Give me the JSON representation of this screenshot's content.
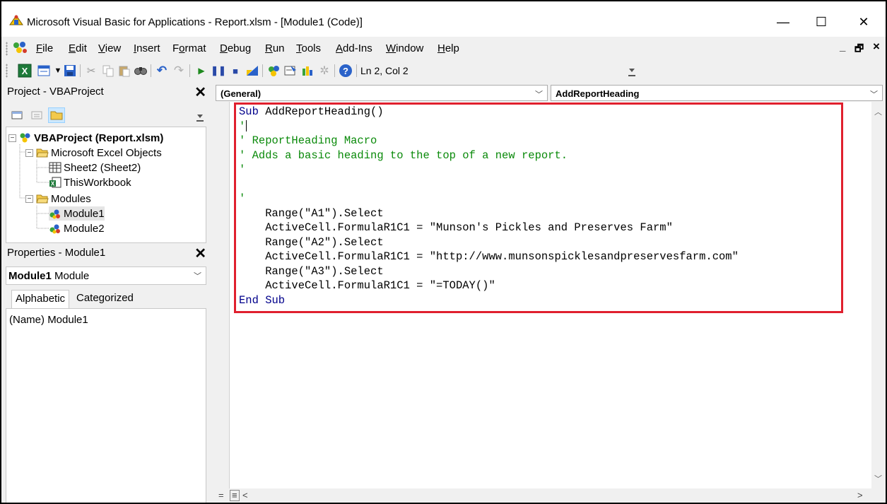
{
  "title": "Microsoft Visual Basic for Applications - Report.xlsm - [Module1 (Code)]",
  "window_controls": {
    "minimize": "—",
    "maximize": "☐",
    "close": "✕"
  },
  "menu": [
    {
      "label": "File",
      "underline": "F"
    },
    {
      "label": "Edit",
      "underline": "E"
    },
    {
      "label": "View",
      "underline": "V"
    },
    {
      "label": "Insert",
      "underline": "I"
    },
    {
      "label": "Format",
      "underline": "o"
    },
    {
      "label": "Debug",
      "underline": "D"
    },
    {
      "label": "Run",
      "underline": "R"
    },
    {
      "label": "Tools",
      "underline": "T"
    },
    {
      "label": "Add-Ins",
      "underline": "A"
    },
    {
      "label": "Window",
      "underline": "W"
    },
    {
      "label": "Help",
      "underline": "H"
    }
  ],
  "mdi_controls": {
    "minimize": "_",
    "restore": "🗗",
    "close": "×"
  },
  "toolbar": {
    "cursor_position": "Ln 2, Col 2",
    "buttons": [
      "view-excel-icon",
      "insert-module-icon",
      "save-icon",
      "cut-icon",
      "copy-icon",
      "paste-icon",
      "find-icon",
      "undo-icon",
      "redo-icon",
      "run-icon",
      "break-icon",
      "reset-icon",
      "design-mode-icon",
      "project-explorer-icon",
      "properties-icon",
      "object-browser-icon",
      "toolbox-icon",
      "help-icon"
    ]
  },
  "project": {
    "title": "Project - VBAProject",
    "close": "✕",
    "tree": {
      "root": "VBAProject (Report.xlsm)",
      "excel_objects_folder": "Microsoft Excel Objects",
      "excel_objects": [
        "Sheet2 (Sheet2)",
        "ThisWorkbook"
      ],
      "modules_folder": "Modules",
      "modules": [
        "Module1",
        "Module2"
      ]
    }
  },
  "properties": {
    "title": "Properties - Module1",
    "close": "✕",
    "object_name": "Module1",
    "object_type": "Module",
    "tabs": [
      "Alphabetic",
      "Categorized"
    ],
    "active_tab": "Alphabetic",
    "rows": [
      {
        "name": "(Name)",
        "value": "Module1"
      }
    ]
  },
  "code_window": {
    "object_combo": "(General)",
    "procedure_combo": "AddReportHeading",
    "lines": [
      {
        "kind": "kw",
        "text": "Sub",
        "rest": " AddReportHeading()"
      },
      {
        "kind": "cm",
        "text": "'",
        "caret": true
      },
      {
        "kind": "cm",
        "text": "' ReportHeading Macro"
      },
      {
        "kind": "cm",
        "text": "' Adds a basic heading to the top of a new report."
      },
      {
        "kind": "cm",
        "text": "'"
      },
      {
        "kind": "blank",
        "text": ""
      },
      {
        "kind": "cm",
        "text": "'"
      },
      {
        "kind": "tx",
        "text": "    Range(\"A1\").Select"
      },
      {
        "kind": "tx",
        "text": "    ActiveCell.FormulaR1C1 = \"Munson's Pickles and Preserves Farm\""
      },
      {
        "kind": "tx",
        "text": "    Range(\"A2\").Select"
      },
      {
        "kind": "tx",
        "text": "    ActiveCell.FormulaR1C1 = \"http://www.munsonspicklesandpreservesfarm.com\""
      },
      {
        "kind": "tx",
        "text": "    Range(\"A3\").Select"
      },
      {
        "kind": "tx",
        "text": "    ActiveCell.FormulaR1C1 = \"=TODAY()\""
      },
      {
        "kind": "kw",
        "text": "End Sub"
      }
    ]
  },
  "highlight_color": "#e0202e"
}
